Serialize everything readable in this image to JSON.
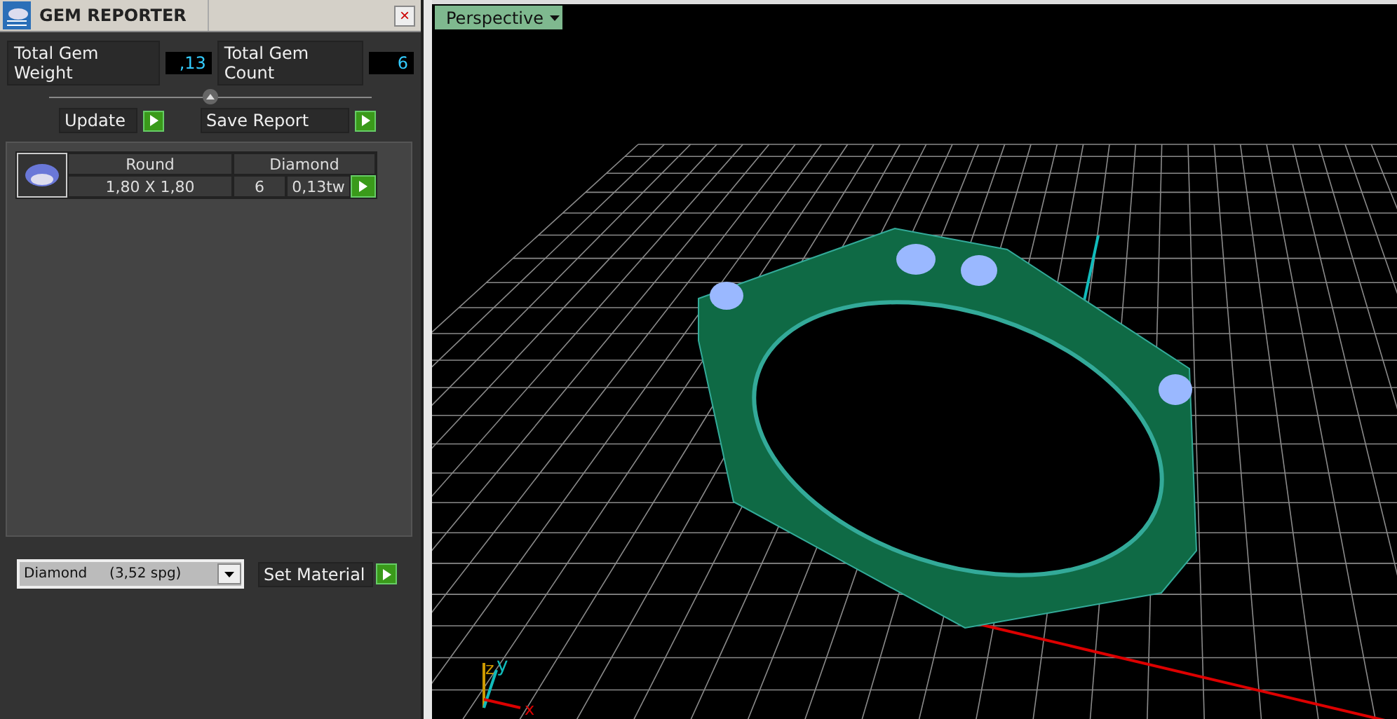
{
  "panel": {
    "title": "GEM REPORTER",
    "close": "×",
    "totals": [
      {
        "label": "Total Gem Weight",
        "value": ",13"
      },
      {
        "label": "Total Gem Count",
        "value": "6"
      }
    ],
    "actions": [
      "Update",
      "Save Report"
    ],
    "gem": {
      "shape": "Round",
      "material": "Diamond",
      "size": "1,80 X 1,80",
      "count": "6",
      "weight": "0,13tw"
    },
    "material_select": {
      "value": "Diamond     (3,52 spg)"
    },
    "set_button": "Set Material"
  },
  "viewport": {
    "view": "Perspective",
    "axes": {
      "x": "x",
      "y": "y",
      "z": "z"
    }
  }
}
